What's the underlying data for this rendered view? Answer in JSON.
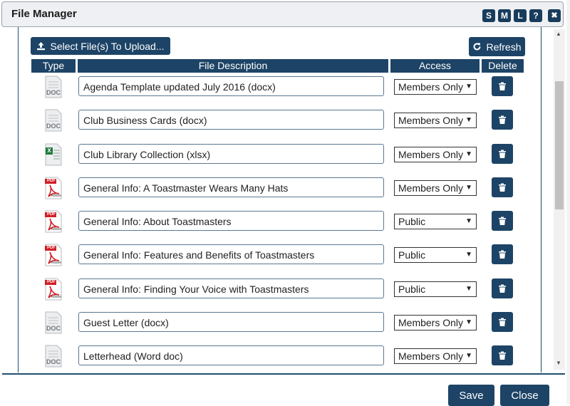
{
  "window": {
    "title": "File Manager",
    "size_buttons": [
      "S",
      "M",
      "L",
      "?"
    ],
    "close_glyph": "✖"
  },
  "toolbar": {
    "upload_label": "Select File(s) To Upload...",
    "refresh_label": "Refresh"
  },
  "table": {
    "headers": [
      "Type",
      "File Description",
      "Access",
      "Delete"
    ],
    "rows": [
      {
        "type": "docx",
        "description": "Agenda Template updated July 2016 (docx)",
        "access": "Members Only"
      },
      {
        "type": "docx",
        "description": "Club Business Cards (docx)",
        "access": "Members Only"
      },
      {
        "type": "xlsx",
        "description": "Club Library Collection (xlsx)",
        "access": "Members Only"
      },
      {
        "type": "pdf",
        "description": "General Info: A Toastmaster Wears Many Hats",
        "access": "Members Only"
      },
      {
        "type": "pdf",
        "description": "General Info: About Toastmasters",
        "access": "Public"
      },
      {
        "type": "pdf",
        "description": "General Info: Features and Benefits of Toastmasters",
        "access": "Public"
      },
      {
        "type": "pdf",
        "description": "General Info: Finding Your Voice with Toastmasters",
        "access": "Public"
      },
      {
        "type": "docx",
        "description": "Guest Letter (docx)",
        "access": "Members Only"
      },
      {
        "type": "docx",
        "description": "Letterhead (Word doc)",
        "access": "Members Only"
      }
    ]
  },
  "icons": {
    "doc_badge": "DOC",
    "pdf_badge": "PDF",
    "pdf_sub": "Adobe",
    "xls_badge": "X"
  },
  "footer": {
    "save_label": "Save",
    "close_label": "Close"
  },
  "colors": {
    "primary": "#1d4466",
    "pdf_red": "#d01f26",
    "excel_green": "#1f7a3b"
  }
}
